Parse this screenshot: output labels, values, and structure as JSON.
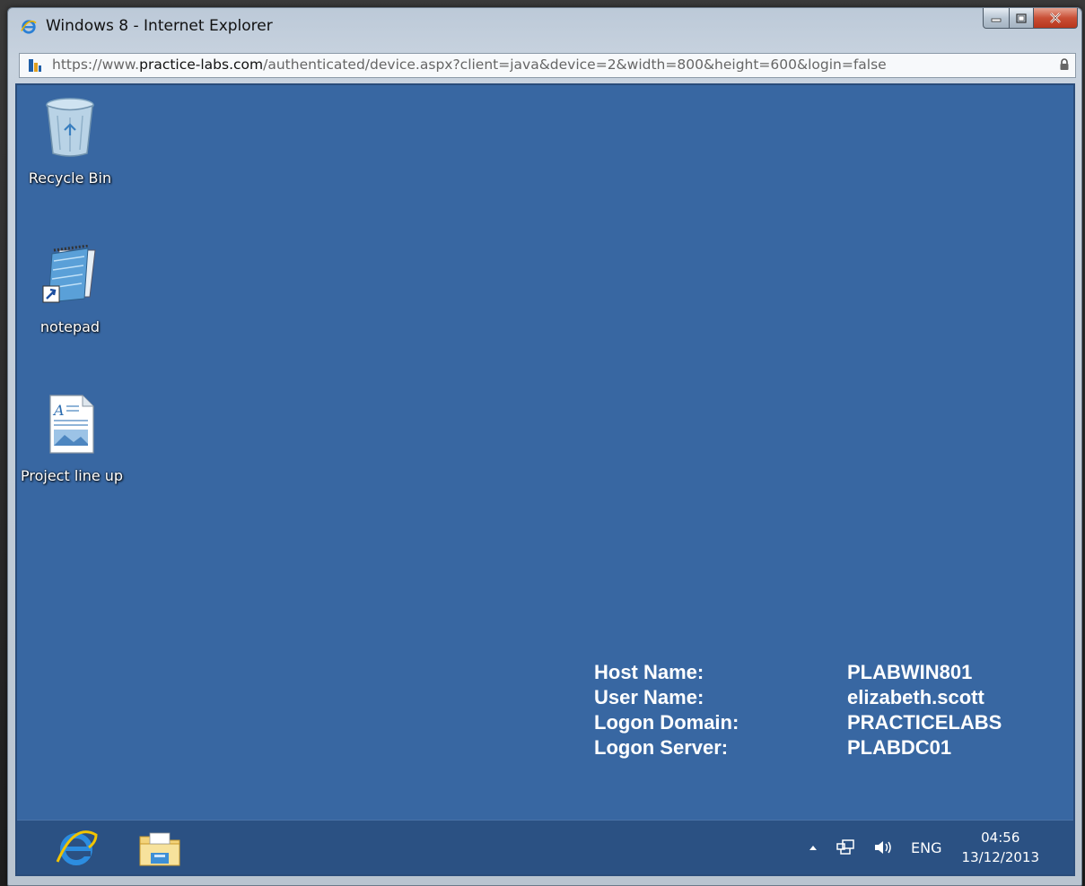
{
  "window": {
    "title": "Windows 8 - Internet Explorer",
    "address": {
      "scheme": "https://",
      "prefix": "www.",
      "host": "practice-labs.com",
      "path": "/authenticated/device.aspx?client=java&device=2&width=800&height=600&login=false"
    }
  },
  "desktop": {
    "background_color": "#3867a2",
    "icons": [
      {
        "label": "Recycle Bin",
        "icon": "recycle-bin-icon"
      },
      {
        "label": "notepad",
        "icon": "notepad-shortcut-icon"
      },
      {
        "label": "Project line up",
        "icon": "wordpad-document-icon"
      }
    ],
    "info": {
      "host_name_label": "Host Name:",
      "host_name_value": "PLABWIN801",
      "user_name_label": "User Name:",
      "user_name_value": "elizabeth.scott",
      "logon_domain_label": "Logon Domain:",
      "logon_domain_value": "PRACTICELABS",
      "logon_server_label": "Logon Server:",
      "logon_server_value": "PLABDC01"
    }
  },
  "taskbar": {
    "pinned": [
      {
        "icon": "internet-explorer-icon"
      },
      {
        "icon": "file-explorer-icon"
      }
    ],
    "tray": {
      "language": "ENG",
      "time": "04:56",
      "date": "13/12/2013"
    }
  }
}
